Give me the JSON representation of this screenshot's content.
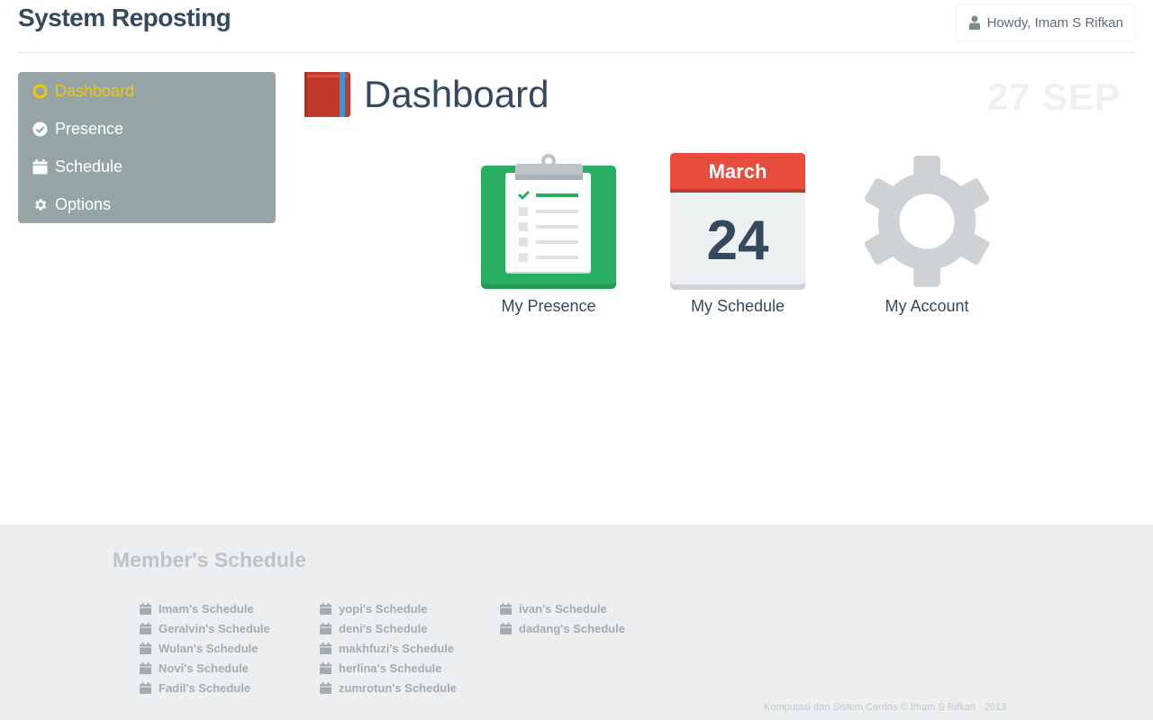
{
  "app": {
    "title": "System Reposting"
  },
  "user": {
    "greeting": "Howdy, Imam S Rifkan"
  },
  "sidebar": {
    "items": [
      {
        "label": "Dashboard",
        "icon": "circle-icon",
        "active": true
      },
      {
        "label": "Presence",
        "icon": "check-circle-icon",
        "active": false
      },
      {
        "label": "Schedule",
        "icon": "calendar-icon",
        "active": false
      },
      {
        "label": "Options",
        "icon": "gear-icon",
        "active": false
      }
    ]
  },
  "main": {
    "title": "Dashboard",
    "date": "27 SEP",
    "tiles": [
      {
        "label": "My Presence",
        "icon": "clipboard-icon"
      },
      {
        "label": "My Schedule",
        "icon": "calendar-page-icon",
        "month": "March",
        "day": "24"
      },
      {
        "label": "My Account",
        "icon": "gear-icon"
      }
    ]
  },
  "footer": {
    "title": "Member's Schedule",
    "columns": [
      [
        "Imam's Schedule",
        "Geralvin's Schedule",
        "Wulan's Schedule",
        "Novi's Schedule",
        "Fadil's Schedule"
      ],
      [
        "yopi's Schedule",
        "deni's Schedule",
        "makhfuzi's Schedule",
        "herlina's Schedule",
        "zumrotun's Schedule"
      ],
      [
        "ivan's Schedule",
        "dadang's Schedule"
      ]
    ],
    "copyright": "Komputasi dan Sistem Cerdas © Imam S Rifkan · 2013"
  },
  "colors": {
    "accent": "#f1c40f",
    "sidebar": "#95a5a6",
    "heading": "#34495e",
    "green": "#27ae60",
    "red": "#e74c3c",
    "footer_bg": "#eceef0"
  }
}
